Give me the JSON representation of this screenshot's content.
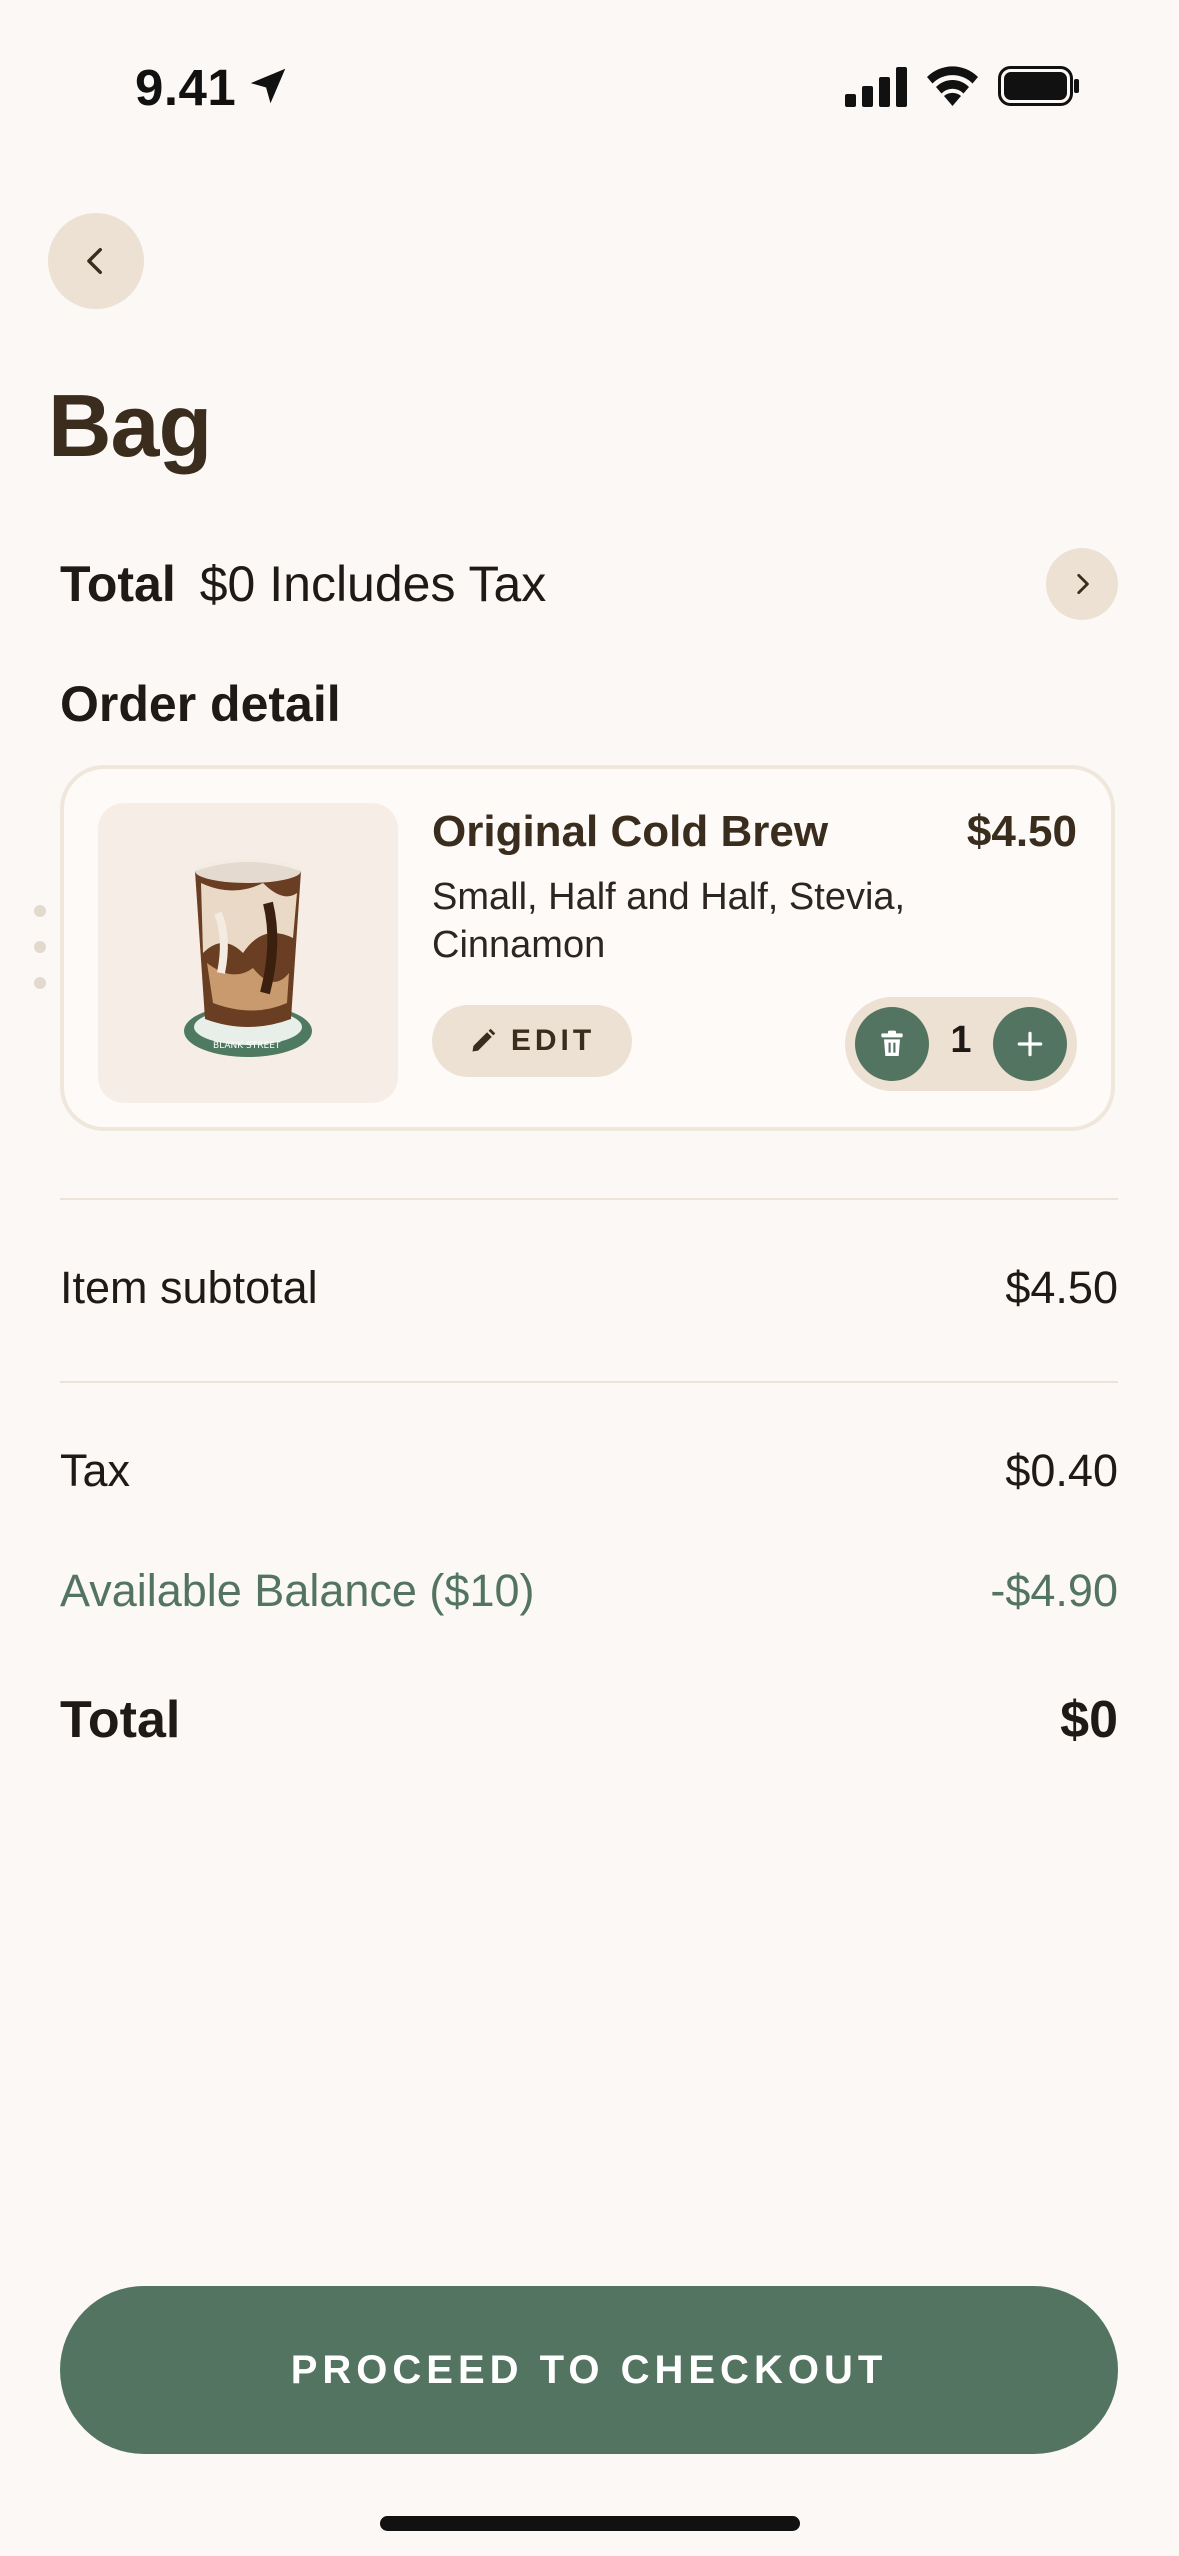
{
  "status_bar": {
    "time": "9.41",
    "icons": [
      "location-arrow-icon",
      "signal-icon",
      "wifi-icon",
      "battery-icon"
    ]
  },
  "header": {
    "back_icon": "chevron-left-icon",
    "title": "Bag"
  },
  "total_summary": {
    "label": "Total",
    "value": "$0 Includes Tax",
    "chevron_icon": "chevron-right-icon"
  },
  "order_detail": {
    "heading": "Order detail",
    "items": [
      {
        "name": "Original Cold Brew",
        "price": "$4.50",
        "options": "Small, Half and Half, Stevia, Cinnamon",
        "image": "cold-brew-cup-image",
        "edit_label": "EDIT",
        "quantity": "1"
      }
    ]
  },
  "summary": {
    "subtotal_label": "Item subtotal",
    "subtotal_value": "$4.50",
    "tax_label": "Tax",
    "tax_value": "$0.40",
    "balance_label": "Available Balance ($10)",
    "balance_value": "-$4.90",
    "total_label": "Total",
    "total_value": "$0"
  },
  "checkout": {
    "label": "PROCEED TO CHECKOUT"
  },
  "colors": {
    "background": "#fcf8f5",
    "accent_green": "#537460",
    "beige": "#ede1d4",
    "title_brown": "#3a2d1e"
  }
}
